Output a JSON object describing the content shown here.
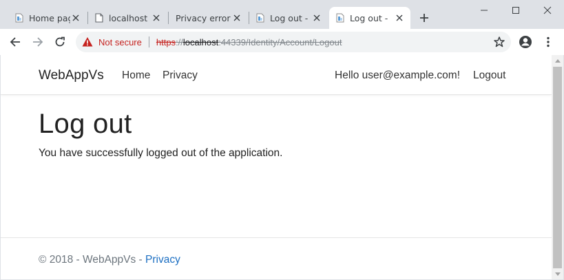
{
  "browser": {
    "tabs": [
      {
        "title": "Home pag",
        "icon": "page-icon",
        "active": false
      },
      {
        "title": "localhost",
        "icon": "document-icon",
        "active": false
      },
      {
        "title": "Privacy error",
        "icon": "none",
        "active": false
      },
      {
        "title": "Log out -",
        "icon": "page-icon",
        "active": false
      },
      {
        "title": "Log out -",
        "icon": "page-icon",
        "active": true
      }
    ],
    "security_label": "Not secure",
    "url": {
      "scheme": "https",
      "host": "localhost",
      "rest": ":44339/Identity/Account/Logout"
    },
    "colors": {
      "warning": "#c5221f",
      "chrome": "#dee1e6"
    }
  },
  "navbar": {
    "brand": "WebAppVs",
    "links": [
      "Home",
      "Privacy"
    ],
    "greeting": "Hello user@example.com!",
    "logout": "Logout"
  },
  "main": {
    "title": "Log out",
    "message": "You have successfully logged out of the application."
  },
  "footer": {
    "copyright": "© 2018 - WebAppVs - ",
    "privacy_link": "Privacy",
    "link_color": "#1b6ec2"
  }
}
